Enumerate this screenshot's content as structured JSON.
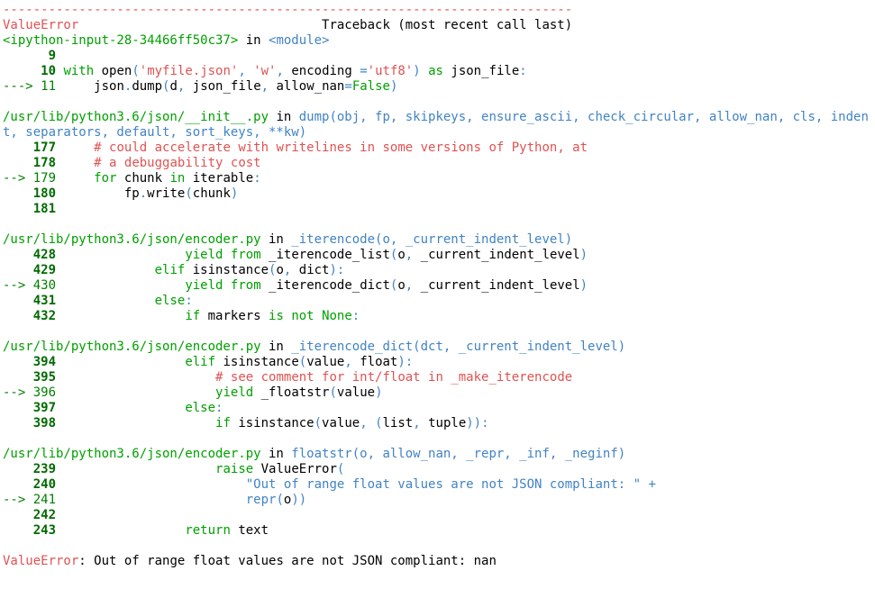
{
  "colors": {
    "error_red": "#e05252",
    "path_green": "#00a000",
    "module_blue": "#4183c4",
    "gutter_green": "#006a00"
  },
  "lines": [
    [
      [
        "red",
        "---------------------------------------------------------------------------"
      ]
    ],
    [
      [
        "red",
        "ValueError"
      ],
      [
        "",
        "                                Traceback (most recent call last)"
      ]
    ],
    [
      [
        "green",
        "<ipython-input-28-34466ff50c37>"
      ],
      [
        "",
        " in "
      ],
      [
        "blue",
        "<module>"
      ]
    ],
    [
      [
        "gutter",
        "      9"
      ]
    ],
    [
      [
        "gutter",
        "     10"
      ],
      [
        "",
        " "
      ],
      [
        "green",
        "with"
      ],
      [
        "",
        " open"
      ],
      [
        "blue",
        "("
      ],
      [
        "red",
        "'myfile.json'"
      ],
      [
        "blue",
        ", "
      ],
      [
        "red",
        "'w'"
      ],
      [
        "blue",
        ", "
      ],
      [
        "",
        "encoding "
      ],
      [
        "blue",
        "="
      ],
      [
        "red",
        "'utf8'"
      ],
      [
        "blue",
        ")"
      ],
      [
        "",
        " "
      ],
      [
        "green",
        "as"
      ],
      [
        "",
        " json_file"
      ],
      [
        "blue",
        ":"
      ]
    ],
    [
      [
        "arrow",
        "---> 11"
      ],
      [
        "",
        "     json"
      ],
      [
        "blue",
        "."
      ],
      [
        "",
        "dump"
      ],
      [
        "blue",
        "("
      ],
      [
        "",
        "d"
      ],
      [
        "blue",
        ","
      ],
      [
        "",
        " json_file"
      ],
      [
        "blue",
        ","
      ],
      [
        "",
        " allow_nan"
      ],
      [
        "blue",
        "="
      ],
      [
        "green",
        "False"
      ],
      [
        "blue",
        ")"
      ]
    ],
    [
      [
        "",
        ""
      ]
    ],
    [
      [
        "green",
        "/usr/lib/python3.6/json/__init__.py"
      ],
      [
        "",
        " in "
      ],
      [
        "blue",
        "dump(obj, fp, skipkeys, ensure_ascii, check_circular, allow_nan, cls, inden"
      ]
    ],
    [
      [
        "blue",
        "t, separators, default, sort_keys, **kw)"
      ]
    ],
    [
      [
        "gutter",
        "    177"
      ],
      [
        "",
        "     "
      ],
      [
        "red",
        "# could accelerate with writelines in some versions of Python, at"
      ]
    ],
    [
      [
        "gutter",
        "    178"
      ],
      [
        "",
        "     "
      ],
      [
        "red",
        "# a debuggability cost"
      ]
    ],
    [
      [
        "arrow",
        "--> 179"
      ],
      [
        "",
        "     "
      ],
      [
        "green",
        "for"
      ],
      [
        "",
        " chunk "
      ],
      [
        "green",
        "in"
      ],
      [
        "",
        " iterable"
      ],
      [
        "blue",
        ":"
      ]
    ],
    [
      [
        "gutter",
        "    180"
      ],
      [
        "",
        "         fp"
      ],
      [
        "blue",
        "."
      ],
      [
        "",
        "write"
      ],
      [
        "blue",
        "("
      ],
      [
        "",
        "chunk"
      ],
      [
        "blue",
        ")"
      ]
    ],
    [
      [
        "gutter",
        "    181"
      ]
    ],
    [
      [
        "",
        ""
      ]
    ],
    [
      [
        "green",
        "/usr/lib/python3.6/json/encoder.py"
      ],
      [
        "",
        " in "
      ],
      [
        "blue",
        "_iterencode(o, _current_indent_level)"
      ]
    ],
    [
      [
        "gutter",
        "    428"
      ],
      [
        "",
        "                 "
      ],
      [
        "green",
        "yield"
      ],
      [
        "",
        " "
      ],
      [
        "green",
        "from"
      ],
      [
        "",
        " _iterencode_list"
      ],
      [
        "blue",
        "("
      ],
      [
        "",
        "o"
      ],
      [
        "blue",
        ","
      ],
      [
        "",
        " _current_indent_level"
      ],
      [
        "blue",
        ")"
      ]
    ],
    [
      [
        "gutter",
        "    429"
      ],
      [
        "",
        "             "
      ],
      [
        "green",
        "elif"
      ],
      [
        "",
        " isinstance"
      ],
      [
        "blue",
        "("
      ],
      [
        "",
        "o"
      ],
      [
        "blue",
        ","
      ],
      [
        "",
        " dict"
      ],
      [
        "blue",
        "):"
      ]
    ],
    [
      [
        "arrow",
        "--> 430"
      ],
      [
        "",
        "                 "
      ],
      [
        "green",
        "yield"
      ],
      [
        "",
        " "
      ],
      [
        "green",
        "from"
      ],
      [
        "",
        " _iterencode_dict"
      ],
      [
        "blue",
        "("
      ],
      [
        "",
        "o"
      ],
      [
        "blue",
        ","
      ],
      [
        "",
        " _current_indent_level"
      ],
      [
        "blue",
        ")"
      ]
    ],
    [
      [
        "gutter",
        "    431"
      ],
      [
        "",
        "             "
      ],
      [
        "green",
        "else"
      ],
      [
        "blue",
        ":"
      ]
    ],
    [
      [
        "gutter",
        "    432"
      ],
      [
        "",
        "                 "
      ],
      [
        "green",
        "if"
      ],
      [
        "",
        " markers "
      ],
      [
        "green",
        "is"
      ],
      [
        "",
        " "
      ],
      [
        "green",
        "not"
      ],
      [
        "",
        " "
      ],
      [
        "green",
        "None"
      ],
      [
        "blue",
        ":"
      ]
    ],
    [
      [
        "",
        ""
      ]
    ],
    [
      [
        "green",
        "/usr/lib/python3.6/json/encoder.py"
      ],
      [
        "",
        " in "
      ],
      [
        "blue",
        "_iterencode_dict(dct, _current_indent_level)"
      ]
    ],
    [
      [
        "gutter",
        "    394"
      ],
      [
        "",
        "                 "
      ],
      [
        "green",
        "elif"
      ],
      [
        "",
        " isinstance"
      ],
      [
        "blue",
        "("
      ],
      [
        "",
        "value"
      ],
      [
        "blue",
        ","
      ],
      [
        "",
        " float"
      ],
      [
        "blue",
        "):"
      ]
    ],
    [
      [
        "gutter",
        "    395"
      ],
      [
        "",
        "                     "
      ],
      [
        "red",
        "# see comment for int/float in _make_iterencode"
      ]
    ],
    [
      [
        "arrow",
        "--> 396"
      ],
      [
        "",
        "                     "
      ],
      [
        "green",
        "yield"
      ],
      [
        "",
        " _floatstr"
      ],
      [
        "blue",
        "("
      ],
      [
        "",
        "value"
      ],
      [
        "blue",
        ")"
      ]
    ],
    [
      [
        "gutter",
        "    397"
      ],
      [
        "",
        "                 "
      ],
      [
        "green",
        "else"
      ],
      [
        "blue",
        ":"
      ]
    ],
    [
      [
        "gutter",
        "    398"
      ],
      [
        "",
        "                     "
      ],
      [
        "green",
        "if"
      ],
      [
        "",
        " isinstance"
      ],
      [
        "blue",
        "("
      ],
      [
        "",
        "value"
      ],
      [
        "blue",
        ","
      ],
      [
        "",
        " "
      ],
      [
        "blue",
        "("
      ],
      [
        "",
        "list"
      ],
      [
        "blue",
        ","
      ],
      [
        "",
        " tuple"
      ],
      [
        "blue",
        ")):"
      ]
    ],
    [
      [
        "",
        ""
      ]
    ],
    [
      [
        "green",
        "/usr/lib/python3.6/json/encoder.py"
      ],
      [
        "",
        " in "
      ],
      [
        "blue",
        "floatstr(o, allow_nan, _repr, _inf, _neginf)"
      ]
    ],
    [
      [
        "gutter",
        "    239"
      ],
      [
        "",
        "                     "
      ],
      [
        "green",
        "raise"
      ],
      [
        "",
        " ValueError"
      ],
      [
        "blue",
        "("
      ]
    ],
    [
      [
        "gutter",
        "    240"
      ],
      [
        "",
        "                         "
      ],
      [
        "blue",
        "\"Out of range float values are not JSON compliant: \" +"
      ]
    ],
    [
      [
        "arrow",
        "--> 241"
      ],
      [
        "",
        "                         "
      ],
      [
        "blue",
        "repr"
      ],
      [
        "blue",
        "("
      ],
      [
        "",
        "o"
      ],
      [
        "blue",
        "))"
      ]
    ],
    [
      [
        "gutter",
        "    242"
      ]
    ],
    [
      [
        "gutter",
        "    243"
      ],
      [
        "",
        "                 "
      ],
      [
        "green",
        "return"
      ],
      [
        "",
        " text"
      ]
    ],
    [
      [
        "",
        ""
      ]
    ],
    [
      [
        "red",
        "ValueError"
      ],
      [
        "",
        ": Out of range float values are not JSON compliant: nan"
      ]
    ]
  ]
}
